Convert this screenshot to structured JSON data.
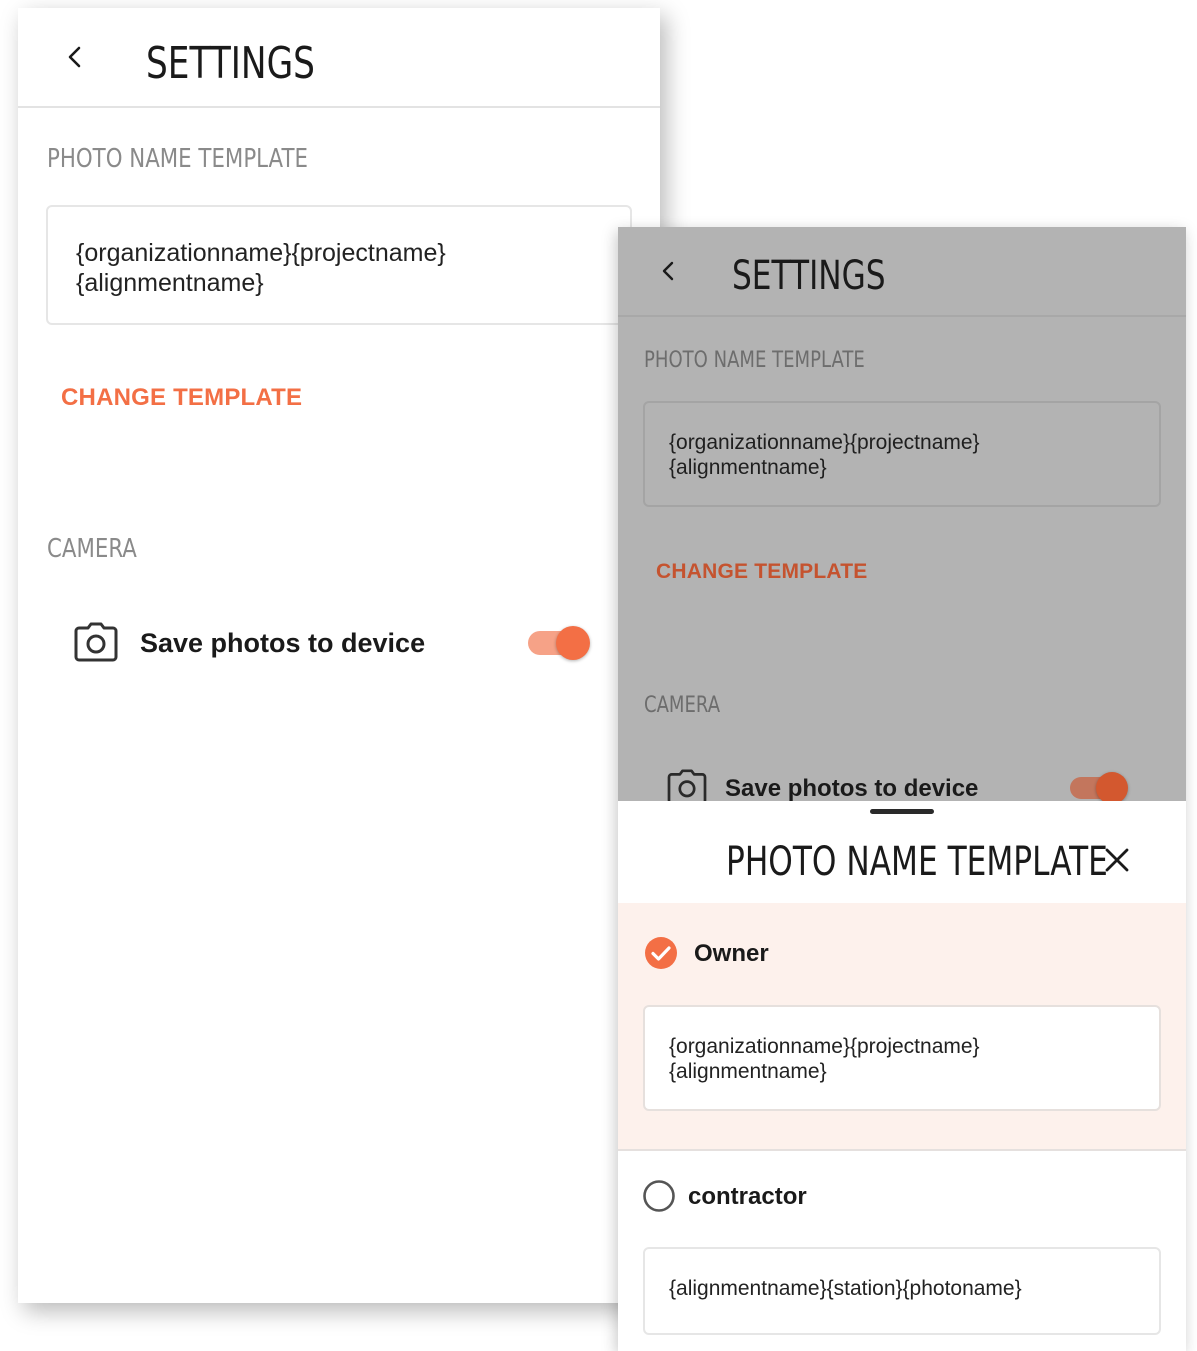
{
  "settings": {
    "title": "SETTINGS",
    "photo_section_label": "PHOTO NAME TEMPLATE",
    "template_line1": "{organizationname}{projectname}",
    "template_line2": "{alignmentname}",
    "change_template_label": "CHANGE TEMPLATE",
    "camera_section_label": "CAMERA",
    "save_photos_label": "Save photos to device",
    "save_photos_enabled": true
  },
  "sheet": {
    "title": "PHOTO NAME TEMPLATE",
    "options": [
      {
        "label": "Owner",
        "selected": true,
        "template_line1": "{organizationname}{projectname}",
        "template_line2": "{alignmentname}"
      },
      {
        "label": "contractor",
        "selected": false,
        "template_line1": "{alignmentname}{station}{photoname}"
      }
    ]
  },
  "colors": {
    "accent": "#f36f45",
    "accent_light": "#f6a287",
    "selected_bg": "#fdf1ec",
    "scrim": "#b3b3b3"
  }
}
